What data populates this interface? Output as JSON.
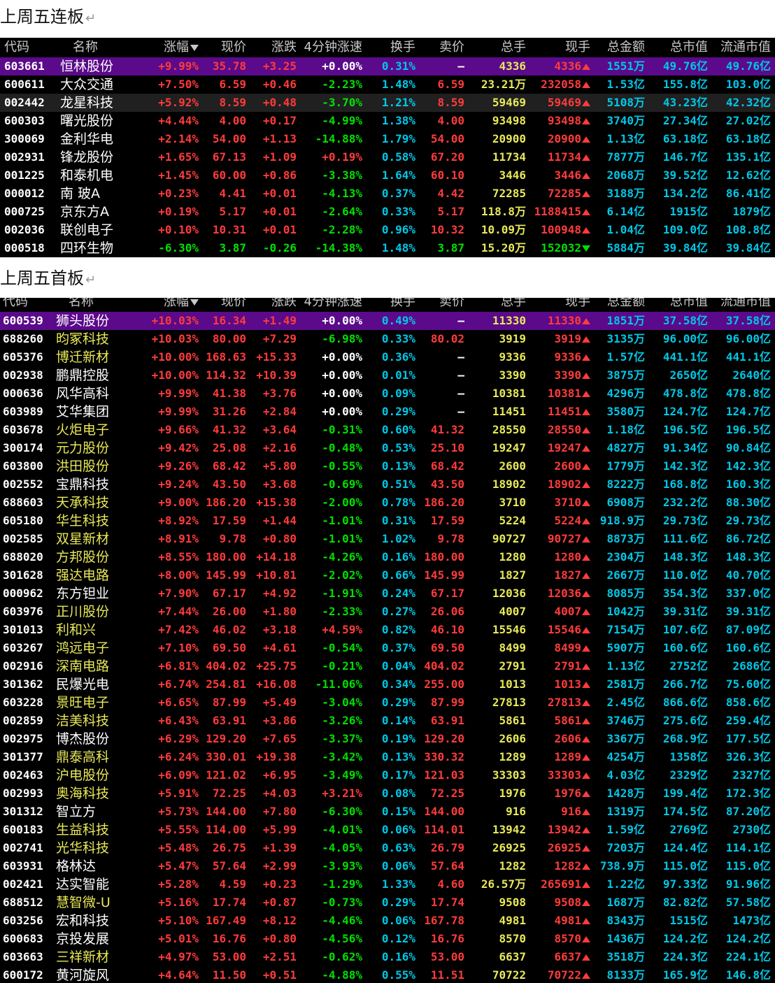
{
  "section1_title": "上周五连板",
  "section2_title": "上周五首板",
  "para_mark": "↵",
  "columns": [
    "代码",
    "名称",
    "涨幅",
    "现价",
    "涨跌",
    "4分钟涨速",
    "换手",
    "卖价",
    "总手",
    "现手",
    "总金额",
    "总市值",
    "流通市值"
  ],
  "sort_icon": "sort-down-arrow-icon",
  "colors": {
    "up": "#ff3b3b",
    "down": "#00e000",
    "cyan": "#00c8e8",
    "yellow": "#e8e85a",
    "selected": "#5a0a8a",
    "background": "#000000"
  },
  "table1": [
    {
      "code": "603661",
      "name": "恒林股份",
      "pct": "+9.99%",
      "price": "35.78",
      "chg": "+3.25",
      "spd": "+0.00%",
      "turn": "0.31%",
      "ask": "–",
      "vol": "4336",
      "cur": "4336",
      "dir": "up",
      "amt": "1551万",
      "mcap": "49.76亿",
      "fcap": "49.76亿"
    },
    {
      "code": "600611",
      "name": "大众交通",
      "pct": "+7.50%",
      "price": "6.59",
      "chg": "+0.46",
      "spd": "-2.23%",
      "turn": "1.48%",
      "ask": "6.59",
      "vol": "23.21万",
      "cur": "232058",
      "dir": "up",
      "amt": "1.53亿",
      "mcap": "155.8亿",
      "fcap": "103.0亿"
    },
    {
      "code": "002442",
      "name": "龙星科技",
      "pct": "+5.92%",
      "price": "8.59",
      "chg": "+0.48",
      "spd": "-3.70%",
      "turn": "1.21%",
      "ask": "8.59",
      "vol": "59469",
      "cur": "59469",
      "dir": "up",
      "amt": "5108万",
      "mcap": "43.23亿",
      "fcap": "42.32亿"
    },
    {
      "code": "600303",
      "name": "曙光股份",
      "pct": "+4.44%",
      "price": "4.00",
      "chg": "+0.17",
      "spd": "-4.99%",
      "turn": "1.38%",
      "ask": "4.00",
      "vol": "93498",
      "cur": "93498",
      "dir": "up",
      "amt": "3740万",
      "mcap": "27.34亿",
      "fcap": "27.02亿"
    },
    {
      "code": "300069",
      "name": "金利华电",
      "pct": "+2.14%",
      "price": "54.00",
      "chg": "+1.13",
      "spd": "-14.88%",
      "turn": "1.79%",
      "ask": "54.00",
      "vol": "20900",
      "cur": "20900",
      "dir": "up",
      "amt": "1.13亿",
      "mcap": "63.18亿",
      "fcap": "63.18亿"
    },
    {
      "code": "002931",
      "name": "锋龙股份",
      "pct": "+1.65%",
      "price": "67.13",
      "chg": "+1.09",
      "spd": "+0.19%",
      "turn": "0.58%",
      "ask": "67.20",
      "vol": "11734",
      "cur": "11734",
      "dir": "up",
      "amt": "7877万",
      "mcap": "146.7亿",
      "fcap": "135.1亿"
    },
    {
      "code": "001225",
      "name": "和泰机电",
      "pct": "+1.45%",
      "price": "60.00",
      "chg": "+0.86",
      "spd": "-3.38%",
      "turn": "1.64%",
      "ask": "60.10",
      "vol": "3446",
      "cur": "3446",
      "dir": "up",
      "amt": "2068万",
      "mcap": "39.52亿",
      "fcap": "12.62亿"
    },
    {
      "code": "000012",
      "name": "南 玻A",
      "pct": "+0.23%",
      "price": "4.41",
      "chg": "+0.01",
      "spd": "-4.13%",
      "turn": "0.37%",
      "ask": "4.42",
      "vol": "72285",
      "cur": "72285",
      "dir": "up",
      "amt": "3188万",
      "mcap": "134.2亿",
      "fcap": "86.41亿"
    },
    {
      "code": "000725",
      "name": "京东方A",
      "pct": "+0.19%",
      "price": "5.17",
      "chg": "+0.01",
      "spd": "-2.64%",
      "turn": "0.33%",
      "ask": "5.17",
      "vol": "118.8万",
      "cur": "1188415",
      "dir": "up",
      "amt": "6.14亿",
      "mcap": "1915亿",
      "fcap": "1879亿"
    },
    {
      "code": "002036",
      "name": "联创电子",
      "pct": "+0.10%",
      "price": "10.31",
      "chg": "+0.01",
      "spd": "-2.28%",
      "turn": "0.96%",
      "ask": "10.32",
      "vol": "10.09万",
      "cur": "100948",
      "dir": "up",
      "amt": "1.04亿",
      "mcap": "109.0亿",
      "fcap": "108.8亿"
    },
    {
      "code": "000518",
      "name": "四环生物",
      "pct": "-6.30%",
      "price": "3.87",
      "chg": "-0.26",
      "spd": "-14.38%",
      "turn": "1.48%",
      "ask": "3.87",
      "vol": "15.20万",
      "cur": "152032",
      "dir": "down",
      "amt": "5884万",
      "mcap": "39.84亿",
      "fcap": "39.84亿"
    }
  ],
  "table2": [
    {
      "code": "600539",
      "name": "狮头股份",
      "pct": "+10.03%",
      "price": "16.34",
      "chg": "+1.49",
      "spd": "+0.00%",
      "turn": "0.49%",
      "ask": "–",
      "vol": "11330",
      "cur": "11330",
      "amt": "1851万",
      "mcap": "37.58亿",
      "fcap": "37.58亿"
    },
    {
      "code": "688260",
      "name": "昀冢科技",
      "pct": "+10.03%",
      "price": "80.00",
      "chg": "+7.29",
      "spd": "-6.98%",
      "turn": "0.33%",
      "ask": "80.02",
      "vol": "3919",
      "cur": "3919",
      "amt": "3135万",
      "mcap": "96.00亿",
      "fcap": "96.00亿"
    },
    {
      "code": "605376",
      "name": "博迁新材",
      "pct": "+10.00%",
      "price": "168.63",
      "chg": "+15.33",
      "spd": "+0.00%",
      "turn": "0.36%",
      "ask": "–",
      "vol": "9336",
      "cur": "9336",
      "amt": "1.57亿",
      "mcap": "441.1亿",
      "fcap": "441.1亿"
    },
    {
      "code": "002938",
      "name": "鹏鼎控股",
      "pct": "+10.00%",
      "price": "114.32",
      "chg": "+10.39",
      "spd": "+0.00%",
      "turn": "0.01%",
      "ask": "–",
      "vol": "3390",
      "cur": "3390",
      "amt": "3875万",
      "mcap": "2650亿",
      "fcap": "2640亿"
    },
    {
      "code": "000636",
      "name": "风华高科",
      "pct": "+9.99%",
      "price": "41.38",
      "chg": "+3.76",
      "spd": "+0.00%",
      "turn": "0.09%",
      "ask": "–",
      "vol": "10381",
      "cur": "10381",
      "amt": "4296万",
      "mcap": "478.8亿",
      "fcap": "478.8亿"
    },
    {
      "code": "603989",
      "name": "艾华集团",
      "pct": "+9.99%",
      "price": "31.26",
      "chg": "+2.84",
      "spd": "+0.00%",
      "turn": "0.29%",
      "ask": "–",
      "vol": "11451",
      "cur": "11451",
      "amt": "3580万",
      "mcap": "124.7亿",
      "fcap": "124.7亿"
    },
    {
      "code": "603678",
      "name": "火炬电子",
      "pct": "+9.66%",
      "price": "41.32",
      "chg": "+3.64",
      "spd": "-0.31%",
      "turn": "0.60%",
      "ask": "41.32",
      "vol": "28550",
      "cur": "28550",
      "amt": "1.18亿",
      "mcap": "196.5亿",
      "fcap": "196.5亿"
    },
    {
      "code": "300174",
      "name": "元力股份",
      "pct": "+9.42%",
      "price": "25.08",
      "chg": "+2.16",
      "spd": "-0.48%",
      "turn": "0.53%",
      "ask": "25.10",
      "vol": "19247",
      "cur": "19247",
      "amt": "4827万",
      "mcap": "91.34亿",
      "fcap": "90.84亿"
    },
    {
      "code": "603800",
      "name": "洪田股份",
      "pct": "+9.26%",
      "price": "68.42",
      "chg": "+5.80",
      "spd": "-0.55%",
      "turn": "0.13%",
      "ask": "68.42",
      "vol": "2600",
      "cur": "2600",
      "amt": "1779万",
      "mcap": "142.3亿",
      "fcap": "142.3亿"
    },
    {
      "code": "002552",
      "name": "宝鼎科技",
      "pct": "+9.24%",
      "price": "43.50",
      "chg": "+3.68",
      "spd": "-0.69%",
      "turn": "0.51%",
      "ask": "43.50",
      "vol": "18902",
      "cur": "18902",
      "amt": "8222万",
      "mcap": "168.8亿",
      "fcap": "160.3亿"
    },
    {
      "code": "688603",
      "name": "天承科技",
      "pct": "+9.00%",
      "price": "186.20",
      "chg": "+15.38",
      "spd": "-2.00%",
      "turn": "0.78%",
      "ask": "186.20",
      "vol": "3710",
      "cur": "3710",
      "amt": "6908万",
      "mcap": "232.2亿",
      "fcap": "88.30亿"
    },
    {
      "code": "605180",
      "name": "华生科技",
      "pct": "+8.92%",
      "price": "17.59",
      "chg": "+1.44",
      "spd": "-1.01%",
      "turn": "0.31%",
      "ask": "17.59",
      "vol": "5224",
      "cur": "5224",
      "amt": "918.9万",
      "mcap": "29.73亿",
      "fcap": "29.73亿"
    },
    {
      "code": "002585",
      "name": "双星新材",
      "pct": "+8.91%",
      "price": "9.78",
      "chg": "+0.80",
      "spd": "-1.01%",
      "turn": "1.02%",
      "ask": "9.78",
      "vol": "90727",
      "cur": "90727",
      "amt": "8873万",
      "mcap": "111.6亿",
      "fcap": "86.72亿"
    },
    {
      "code": "688020",
      "name": "方邦股份",
      "pct": "+8.55%",
      "price": "180.00",
      "chg": "+14.18",
      "spd": "-4.26%",
      "turn": "0.16%",
      "ask": "180.00",
      "vol": "1280",
      "cur": "1280",
      "amt": "2304万",
      "mcap": "148.3亿",
      "fcap": "148.3亿"
    },
    {
      "code": "301628",
      "name": "强达电路",
      "pct": "+8.00%",
      "price": "145.99",
      "chg": "+10.81",
      "spd": "-2.02%",
      "turn": "0.66%",
      "ask": "145.99",
      "vol": "1827",
      "cur": "1827",
      "amt": "2667万",
      "mcap": "110.0亿",
      "fcap": "40.70亿"
    },
    {
      "code": "000962",
      "name": "东方钽业",
      "pct": "+7.90%",
      "price": "67.17",
      "chg": "+4.92",
      "spd": "-1.91%",
      "turn": "0.24%",
      "ask": "67.17",
      "vol": "12036",
      "cur": "12036",
      "amt": "8085万",
      "mcap": "354.3亿",
      "fcap": "337.0亿"
    },
    {
      "code": "603976",
      "name": "正川股份",
      "pct": "+7.44%",
      "price": "26.00",
      "chg": "+1.80",
      "spd": "-2.33%",
      "turn": "0.27%",
      "ask": "26.06",
      "vol": "4007",
      "cur": "4007",
      "amt": "1042万",
      "mcap": "39.31亿",
      "fcap": "39.31亿"
    },
    {
      "code": "301013",
      "name": "利和兴",
      "pct": "+7.42%",
      "price": "46.02",
      "chg": "+3.18",
      "spd": "+4.59%",
      "turn": "0.82%",
      "ask": "46.10",
      "vol": "15546",
      "cur": "15546",
      "amt": "7154万",
      "mcap": "107.6亿",
      "fcap": "87.09亿"
    },
    {
      "code": "603267",
      "name": "鸿远电子",
      "pct": "+7.10%",
      "price": "69.50",
      "chg": "+4.61",
      "spd": "-0.54%",
      "turn": "0.37%",
      "ask": "69.50",
      "vol": "8499",
      "cur": "8499",
      "amt": "5907万",
      "mcap": "160.6亿",
      "fcap": "160.6亿"
    },
    {
      "code": "002916",
      "name": "深南电路",
      "pct": "+6.81%",
      "price": "404.02",
      "chg": "+25.75",
      "spd": "-0.21%",
      "turn": "0.04%",
      "ask": "404.02",
      "vol": "2791",
      "cur": "2791",
      "amt": "1.13亿",
      "mcap": "2752亿",
      "fcap": "2686亿"
    },
    {
      "code": "301362",
      "name": "民爆光电",
      "pct": "+6.74%",
      "price": "254.81",
      "chg": "+16.08",
      "spd": "-11.06%",
      "turn": "0.34%",
      "ask": "255.00",
      "vol": "1013",
      "cur": "1013",
      "amt": "2581万",
      "mcap": "266.7亿",
      "fcap": "75.60亿"
    },
    {
      "code": "603228",
      "name": "景旺电子",
      "pct": "+6.65%",
      "price": "87.99",
      "chg": "+5.49",
      "spd": "-3.04%",
      "turn": "0.29%",
      "ask": "87.99",
      "vol": "27813",
      "cur": "27813",
      "amt": "2.45亿",
      "mcap": "866.6亿",
      "fcap": "858.6亿"
    },
    {
      "code": "002859",
      "name": "洁美科技",
      "pct": "+6.43%",
      "price": "63.91",
      "chg": "+3.86",
      "spd": "-3.26%",
      "turn": "0.14%",
      "ask": "63.91",
      "vol": "5861",
      "cur": "5861",
      "amt": "3746万",
      "mcap": "275.6亿",
      "fcap": "259.4亿"
    },
    {
      "code": "002975",
      "name": "博杰股份",
      "pct": "+6.29%",
      "price": "129.20",
      "chg": "+7.65",
      "spd": "-3.37%",
      "turn": "0.19%",
      "ask": "129.20",
      "vol": "2606",
      "cur": "2606",
      "amt": "3367万",
      "mcap": "268.9亿",
      "fcap": "177.5亿"
    },
    {
      "code": "301377",
      "name": "鼎泰高科",
      "pct": "+6.24%",
      "price": "330.01",
      "chg": "+19.38",
      "spd": "-3.42%",
      "turn": "0.13%",
      "ask": "330.32",
      "vol": "1289",
      "cur": "1289",
      "amt": "4254万",
      "mcap": "1358亿",
      "fcap": "326.3亿"
    },
    {
      "code": "002463",
      "name": "沪电股份",
      "pct": "+6.09%",
      "price": "121.02",
      "chg": "+6.95",
      "spd": "-3.49%",
      "turn": "0.17%",
      "ask": "121.03",
      "vol": "33303",
      "cur": "33303",
      "amt": "4.03亿",
      "mcap": "2329亿",
      "fcap": "2327亿"
    },
    {
      "code": "002993",
      "name": "奥海科技",
      "pct": "+5.91%",
      "price": "72.25",
      "chg": "+4.03",
      "spd": "+3.21%",
      "turn": "0.08%",
      "ask": "72.25",
      "vol": "1976",
      "cur": "1976",
      "amt": "1428万",
      "mcap": "199.4亿",
      "fcap": "172.3亿"
    },
    {
      "code": "301312",
      "name": "智立方",
      "pct": "+5.73%",
      "price": "144.00",
      "chg": "+7.80",
      "spd": "-6.30%",
      "turn": "0.15%",
      "ask": "144.00",
      "vol": "916",
      "cur": "916",
      "amt": "1319万",
      "mcap": "174.5亿",
      "fcap": "87.20亿"
    },
    {
      "code": "600183",
      "name": "生益科技",
      "pct": "+5.55%",
      "price": "114.00",
      "chg": "+5.99",
      "spd": "-4.01%",
      "turn": "0.06%",
      "ask": "114.01",
      "vol": "13942",
      "cur": "13942",
      "amt": "1.59亿",
      "mcap": "2769亿",
      "fcap": "2730亿"
    },
    {
      "code": "002741",
      "name": "光华科技",
      "pct": "+5.48%",
      "price": "26.75",
      "chg": "+1.39",
      "spd": "-4.05%",
      "turn": "0.63%",
      "ask": "26.79",
      "vol": "26925",
      "cur": "26925",
      "amt": "7203万",
      "mcap": "124.4亿",
      "fcap": "114.1亿"
    },
    {
      "code": "603931",
      "name": "格林达",
      "pct": "+5.47%",
      "price": "57.64",
      "chg": "+2.99",
      "spd": "-3.93%",
      "turn": "0.06%",
      "ask": "57.64",
      "vol": "1282",
      "cur": "1282",
      "amt": "738.9万",
      "mcap": "115.0亿",
      "fcap": "115.0亿"
    },
    {
      "code": "002421",
      "name": "达实智能",
      "pct": "+5.28%",
      "price": "4.59",
      "chg": "+0.23",
      "spd": "-1.29%",
      "turn": "1.33%",
      "ask": "4.60",
      "vol": "26.57万",
      "cur": "265691",
      "amt": "1.22亿",
      "mcap": "97.33亿",
      "fcap": "91.96亿"
    },
    {
      "code": "688512",
      "name": "慧智微-U",
      "pct": "+5.16%",
      "price": "17.74",
      "chg": "+0.87",
      "spd": "-0.73%",
      "turn": "0.29%",
      "ask": "17.74",
      "vol": "9508",
      "cur": "9508",
      "amt": "1687万",
      "mcap": "82.82亿",
      "fcap": "57.58亿"
    },
    {
      "code": "603256",
      "name": "宏和科技",
      "pct": "+5.10%",
      "price": "167.49",
      "chg": "+8.12",
      "spd": "-4.46%",
      "turn": "0.06%",
      "ask": "167.78",
      "vol": "4981",
      "cur": "4981",
      "amt": "8343万",
      "mcap": "1515亿",
      "fcap": "1473亿"
    },
    {
      "code": "600683",
      "name": "京投发展",
      "pct": "+5.01%",
      "price": "16.76",
      "chg": "+0.80",
      "spd": "-4.56%",
      "turn": "0.12%",
      "ask": "16.76",
      "vol": "8570",
      "cur": "8570",
      "amt": "1436万",
      "mcap": "124.2亿",
      "fcap": "124.2亿"
    },
    {
      "code": "603663",
      "name": "三祥新材",
      "pct": "+4.97%",
      "price": "53.00",
      "chg": "+2.51",
      "spd": "-0.62%",
      "turn": "0.16%",
      "ask": "53.00",
      "vol": "6637",
      "cur": "6637",
      "amt": "3518万",
      "mcap": "224.3亿",
      "fcap": "224.1亿"
    },
    {
      "code": "600172",
      "name": "黄河旋风",
      "pct": "+4.64%",
      "price": "11.50",
      "chg": "+0.51",
      "spd": "-4.88%",
      "turn": "0.55%",
      "ask": "11.51",
      "vol": "70722",
      "cur": "70722",
      "amt": "8133万",
      "mcap": "165.9亿",
      "fcap": "146.8亿"
    }
  ],
  "table2_yellow_names": [
    "688260",
    "605376",
    "603678",
    "300174",
    "603800",
    "688603",
    "605180",
    "002585",
    "688020",
    "301628",
    "603976",
    "301013",
    "603267",
    "002916",
    "603228",
    "002859",
    "301377",
    "002463",
    "002993",
    "600183",
    "002741",
    "688512",
    "603663"
  ]
}
